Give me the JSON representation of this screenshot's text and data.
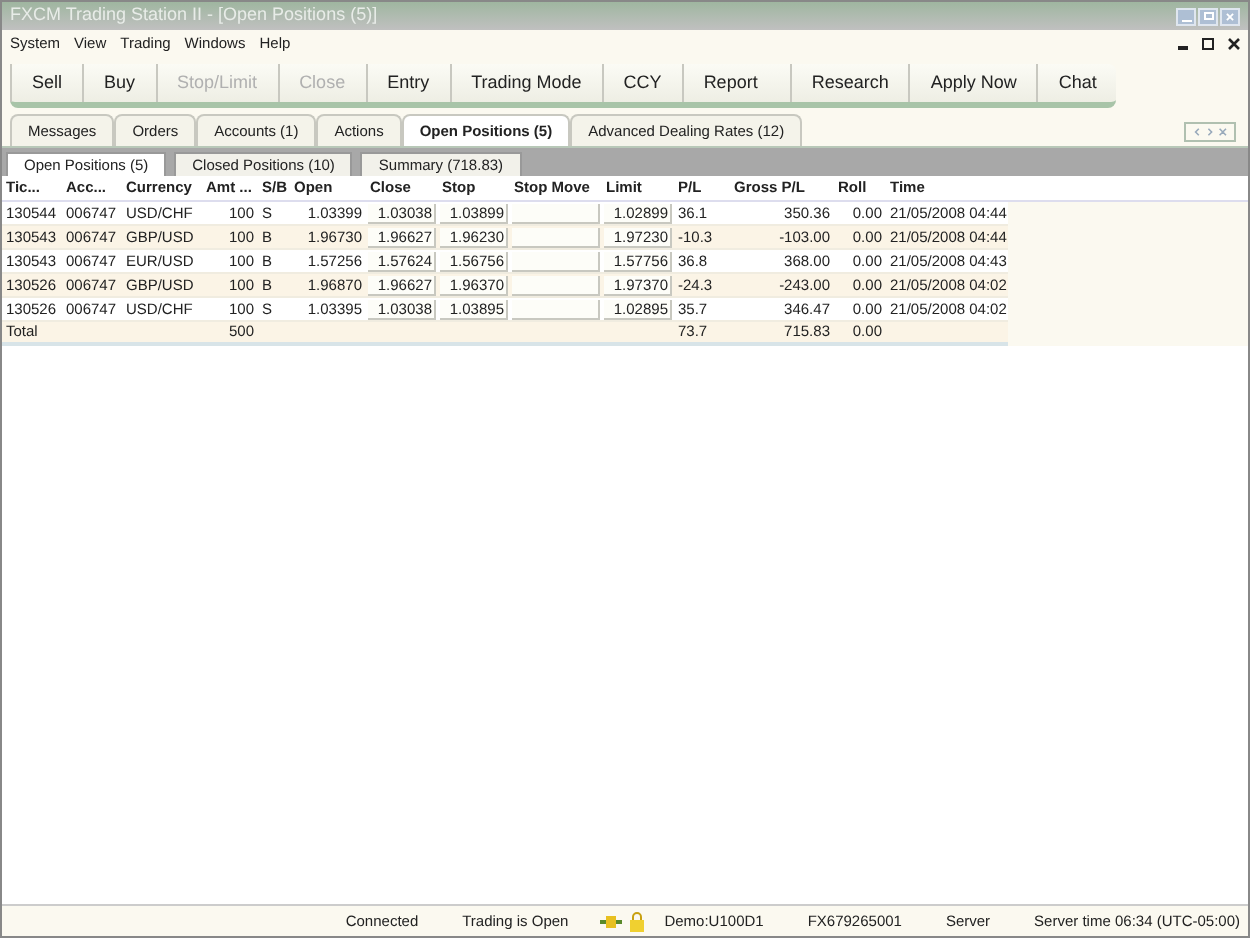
{
  "window": {
    "title": "FXCM Trading Station II - [Open Positions (5)]"
  },
  "menu": [
    "System",
    "View",
    "Trading",
    "Windows",
    "Help"
  ],
  "toolbar": [
    {
      "label": "Sell",
      "disabled": false
    },
    {
      "label": "Buy",
      "disabled": false
    },
    {
      "label": "Stop/Limit",
      "disabled": true
    },
    {
      "label": "Close",
      "disabled": true
    },
    {
      "label": "Entry",
      "disabled": false
    },
    {
      "label": "Trading Mode",
      "disabled": false
    },
    {
      "label": "CCY",
      "disabled": false
    },
    {
      "label": "Report",
      "disabled": false
    },
    {
      "label": "Research",
      "disabled": false
    },
    {
      "label": "Apply Now",
      "disabled": false
    },
    {
      "label": "Chat",
      "disabled": false
    }
  ],
  "tabs": [
    {
      "label": "Messages",
      "selected": false
    },
    {
      "label": "Orders",
      "selected": false
    },
    {
      "label": "Accounts (1)",
      "selected": false
    },
    {
      "label": "Actions",
      "selected": false
    },
    {
      "label": "Open Positions (5)",
      "selected": true
    },
    {
      "label": "Advanced Dealing Rates (12)",
      "selected": false
    }
  ],
  "subtabs": [
    {
      "label": "Open Positions (5)",
      "selected": true
    },
    {
      "label": "Closed Positions (10)",
      "selected": false
    },
    {
      "label": "Summary (718.83)",
      "selected": false
    }
  ],
  "table": {
    "columns": [
      "Tic...",
      "Acc...",
      "Currency",
      "Amt ...",
      "S/B",
      "Open",
      "Close",
      "Stop",
      "Stop Move",
      "Limit",
      "P/L",
      "Gross P/L",
      "Roll",
      "Time"
    ],
    "rows": [
      [
        "130544",
        "006747",
        "USD/CHF",
        "100",
        "S",
        "1.03399",
        "1.03038",
        "1.03899",
        "",
        "1.02899",
        "36.1",
        "350.36",
        "0.00",
        "21/05/2008 04:44"
      ],
      [
        "130543",
        "006747",
        "GBP/USD",
        "100",
        "B",
        "1.96730",
        "1.96627",
        "1.96230",
        "",
        "1.97230",
        "-10.3",
        "-103.00",
        "0.00",
        "21/05/2008 04:44"
      ],
      [
        "130543",
        "006747",
        "EUR/USD",
        "100",
        "B",
        "1.57256",
        "1.57624",
        "1.56756",
        "",
        "1.57756",
        "36.8",
        "368.00",
        "0.00",
        "21/05/2008 04:43"
      ],
      [
        "130526",
        "006747",
        "GBP/USD",
        "100",
        "B",
        "1.96870",
        "1.96627",
        "1.96370",
        "",
        "1.97370",
        "-24.3",
        "-243.00",
        "0.00",
        "21/05/2008 04:02"
      ],
      [
        "130526",
        "006747",
        "USD/CHF",
        "100",
        "S",
        "1.03395",
        "1.03038",
        "1.03895",
        "",
        "1.02895",
        "35.7",
        "346.47",
        "0.00",
        "21/05/2008 04:02"
      ]
    ],
    "total": {
      "label": "Total",
      "amount": "500",
      "pl": "73.7",
      "gross_pl": "715.83",
      "roll": "0.00"
    }
  },
  "status_bar": [
    "Connected",
    "Trading is Open",
    "Demo:U100D1",
    "FX679265001",
    "Server",
    "Server time 06:34 (UTC-05:00)"
  ]
}
